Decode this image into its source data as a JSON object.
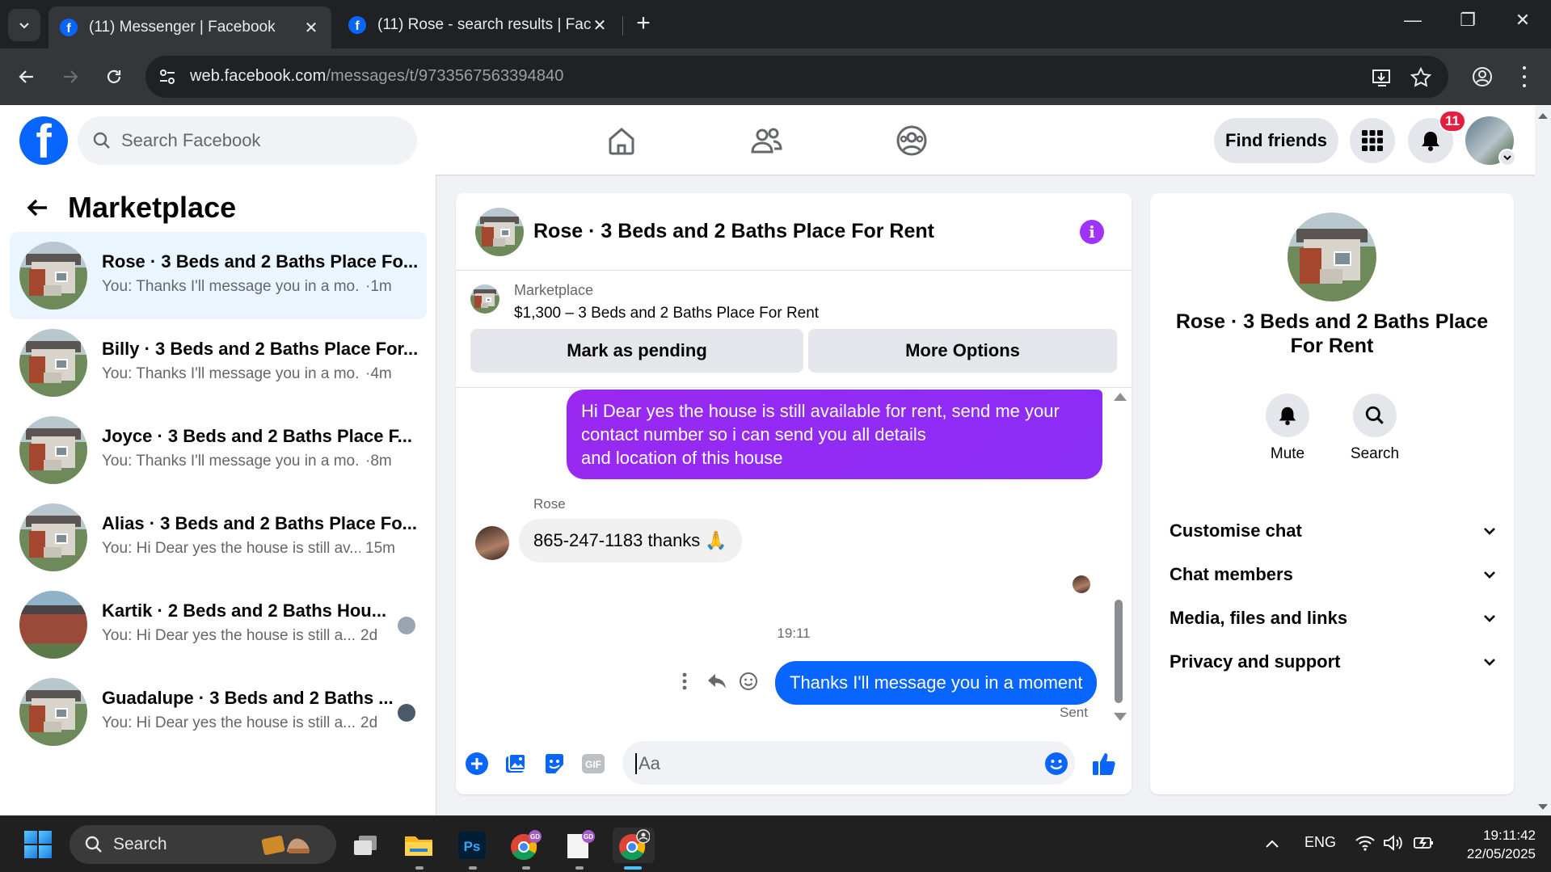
{
  "browser": {
    "tabs": [
      {
        "title": "(11) Messenger | Facebook",
        "active": true
      },
      {
        "title": "(11) Rose - search results | Facebook",
        "active": false
      }
    ],
    "url_host": "web.facebook.com",
    "url_path": "/messages/t/9733567563394840"
  },
  "fb_header": {
    "search_placeholder": "Search Facebook",
    "find_friends": "Find friends",
    "notification_count": "11"
  },
  "sidebar": {
    "title": "Marketplace",
    "conversations": [
      {
        "title": "Rose · 3 Beds and 2 Baths Place Fo...",
        "preview": "You: Thanks I'll message you in a mo...",
        "time": "·1m",
        "selected": true
      },
      {
        "title": "Billy · 3 Beds and 2 Baths Place For...",
        "preview": "You: Thanks I'll message you in a mo...",
        "time": "·4m"
      },
      {
        "title": "Joyce · 3 Beds and 2 Baths Place F...",
        "preview": "You: Thanks I'll message you in a mo...",
        "time": "·8m"
      },
      {
        "title": "Alias · 3 Beds and 2 Baths Place Fo...",
        "preview": "You: Hi Dear yes the house is still av...",
        "time": "15m"
      },
      {
        "title": "Kartik · 2 Beds and 2 Baths Hou...",
        "preview": "You: Hi Dear yes the house is still a...",
        "time": "2d"
      },
      {
        "title": "Guadalupe · 3 Beds and 2 Baths ...",
        "preview": "You: Hi Dear yes the house is still a...",
        "time": "2d"
      }
    ]
  },
  "chat": {
    "title": "Rose · 3 Beds and 2 Baths Place For Rent",
    "listing_label": "Marketplace",
    "listing_price": "$1,300 – 3 Beds and 2 Baths Place For Rent",
    "mark_pending": "Mark as pending",
    "more_options": "More Options",
    "outgoing_1": "Hi Dear yes the house is still available for rent, send me your contact number so i can send you all details\nand location of this house",
    "sender_name": "Rose",
    "incoming_1": "865-247-1183 thanks 🙏",
    "timestamp": "19:11",
    "outgoing_2": "Thanks I'll message you in a moment",
    "status": "Sent",
    "composer_placeholder": "Aa"
  },
  "info_panel": {
    "title": "Rose · 3 Beds and 2 Baths Place For Rent",
    "mute": "Mute",
    "search": "Search",
    "sections": [
      "Customise chat",
      "Chat members",
      "Media, files and links",
      "Privacy and support"
    ]
  },
  "taskbar": {
    "search": "Search",
    "language": "ENG",
    "time": "19:11:42",
    "date": "22/05/2025"
  },
  "colors": {
    "fb_blue": "#0866ff",
    "messenger_purple": "#8a2ef8",
    "notification_red": "#e41e3f"
  }
}
